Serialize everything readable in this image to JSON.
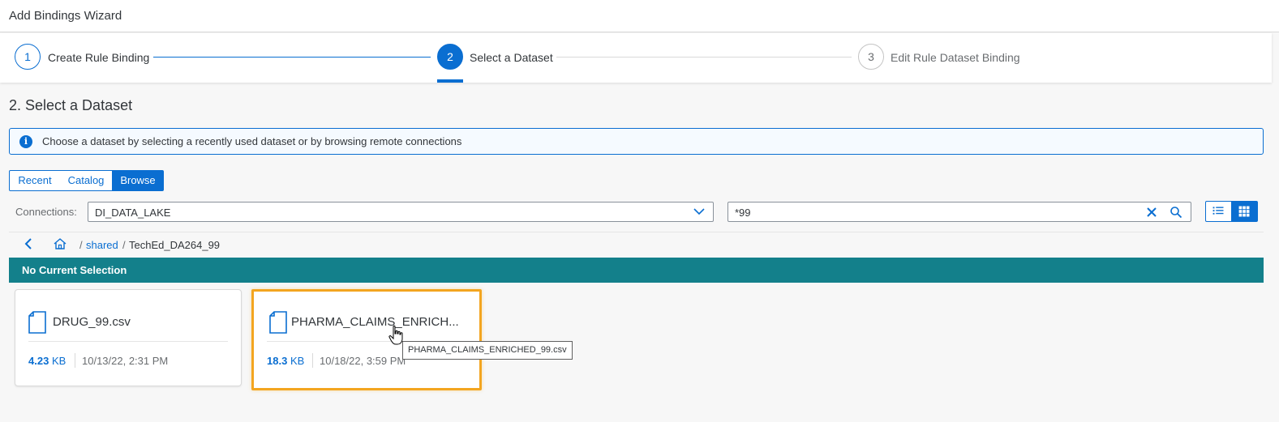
{
  "window": {
    "title": "Add Bindings Wizard"
  },
  "wizard": {
    "steps": [
      {
        "number": "1",
        "label": "Create Rule Binding"
      },
      {
        "number": "2",
        "label": "Select a Dataset"
      },
      {
        "number": "3",
        "label": "Edit Rule Dataset Binding"
      }
    ]
  },
  "page": {
    "heading": "2. Select a Dataset"
  },
  "info": {
    "message": "Choose a dataset by selecting a recently used dataset or by browsing remote connections",
    "icon": "info-icon"
  },
  "tabs": [
    {
      "label": "Recent"
    },
    {
      "label": "Catalog"
    },
    {
      "label": "Browse"
    }
  ],
  "filters": {
    "connections_label": "Connections:",
    "connection_value": "DI_DATA_LAKE",
    "search_value": "*99"
  },
  "breadcrumb": {
    "sep1": "/",
    "shared": "shared",
    "sep2": "/",
    "current": "TechEd_DA264_99"
  },
  "selection": {
    "status": "No Current Selection"
  },
  "files": [
    {
      "name": "DRUG_99.csv",
      "size_value": "4.23",
      "size_unit": "KB",
      "date": "10/13/22, 2:31 PM"
    },
    {
      "name": "PHARMA_CLAIMS_ENRICH...",
      "size_value": "18.3",
      "size_unit": "KB",
      "date": "10/18/22, 3:59 PM"
    }
  ],
  "tooltip": {
    "text": "PHARMA_CLAIMS_ENRICHED_99.csv"
  },
  "colors": {
    "accent": "#0a6ed1",
    "selection_bar": "#13808b",
    "focus": "#f3a520"
  }
}
